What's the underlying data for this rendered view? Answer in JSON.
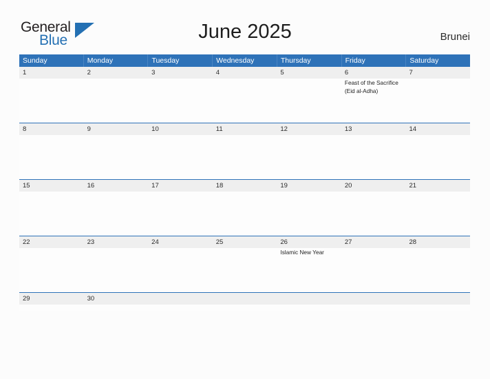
{
  "brand": {
    "name_top": "General",
    "name_bottom": "Blue",
    "accent_color": "#2470b3"
  },
  "header": {
    "title": "June 2025",
    "country": "Brunei"
  },
  "theme": {
    "header_blue": "#2e72b8",
    "date_band_gray": "#efefef",
    "page_background": "#fcfcfc"
  },
  "calendar": {
    "day_names": [
      "Sunday",
      "Monday",
      "Tuesday",
      "Wednesday",
      "Thursday",
      "Friday",
      "Saturday"
    ],
    "weeks": [
      {
        "days": [
          {
            "date": "1",
            "event": ""
          },
          {
            "date": "2",
            "event": ""
          },
          {
            "date": "3",
            "event": ""
          },
          {
            "date": "4",
            "event": ""
          },
          {
            "date": "5",
            "event": ""
          },
          {
            "date": "6",
            "event": "Feast of the Sacrifice (Eid al-Adha)"
          },
          {
            "date": "7",
            "event": ""
          }
        ]
      },
      {
        "days": [
          {
            "date": "8",
            "event": ""
          },
          {
            "date": "9",
            "event": ""
          },
          {
            "date": "10",
            "event": ""
          },
          {
            "date": "11",
            "event": ""
          },
          {
            "date": "12",
            "event": ""
          },
          {
            "date": "13",
            "event": ""
          },
          {
            "date": "14",
            "event": ""
          }
        ]
      },
      {
        "days": [
          {
            "date": "15",
            "event": ""
          },
          {
            "date": "16",
            "event": ""
          },
          {
            "date": "17",
            "event": ""
          },
          {
            "date": "18",
            "event": ""
          },
          {
            "date": "19",
            "event": ""
          },
          {
            "date": "20",
            "event": ""
          },
          {
            "date": "21",
            "event": ""
          }
        ]
      },
      {
        "days": [
          {
            "date": "22",
            "event": ""
          },
          {
            "date": "23",
            "event": ""
          },
          {
            "date": "24",
            "event": ""
          },
          {
            "date": "25",
            "event": ""
          },
          {
            "date": "26",
            "event": "Islamic New Year"
          },
          {
            "date": "27",
            "event": ""
          },
          {
            "date": "28",
            "event": ""
          }
        ]
      },
      {
        "days": [
          {
            "date": "29",
            "event": ""
          },
          {
            "date": "30",
            "event": ""
          },
          {
            "date": "",
            "event": ""
          },
          {
            "date": "",
            "event": ""
          },
          {
            "date": "",
            "event": ""
          },
          {
            "date": "",
            "event": ""
          },
          {
            "date": "",
            "event": ""
          }
        ]
      }
    ]
  }
}
